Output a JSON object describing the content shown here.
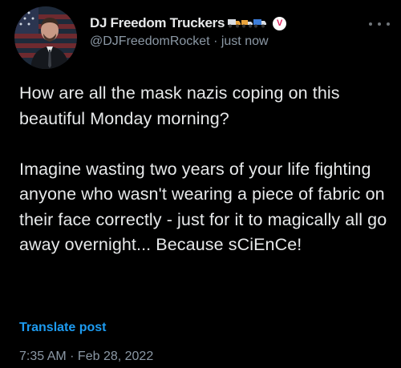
{
  "post": {
    "author": {
      "display_name": "DJ Freedom Truckers",
      "name_emojis": [
        "truck-emoji",
        "truck-emoji",
        "truck-emoji"
      ],
      "verified_badge_letter": "V",
      "handle": "@DJFreedomRocket",
      "separator": " · ",
      "relative_time": "just now"
    },
    "text": {
      "paragraph_1": "How are all the mask nazis coping on this beautiful Monday morning?",
      "paragraph_2": "Imagine wasting two years of your life fighting anyone who wasn't wearing a piece of fabric on their face correctly - just for it to magically all go away overnight... Because sCiEnCe!"
    },
    "translate_label": "Translate post",
    "timestamp": "7:35 AM · Feb 28, 2022"
  },
  "colors": {
    "background": "#000000",
    "primary_text": "#e7e9ea",
    "secondary_text": "#8b98a5",
    "link": "#1d9bf0",
    "badge": "#e0245e"
  },
  "icons": {
    "more": "more-horizontal-icon",
    "verified": "verified-badge-icon",
    "avatar": "profile-avatar"
  }
}
